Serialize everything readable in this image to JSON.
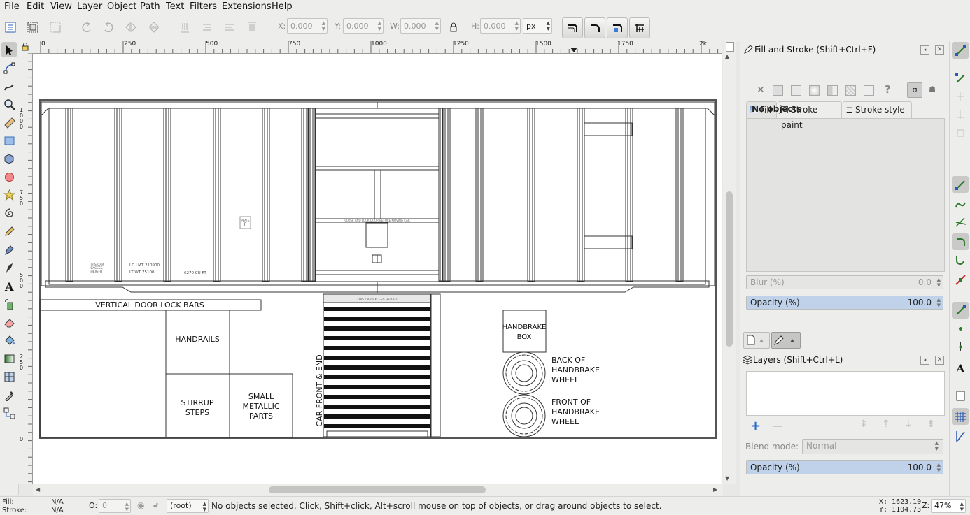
{
  "menu": [
    "File",
    "Edit",
    "View",
    "Layer",
    "Object",
    "Path",
    "Text",
    "Filters",
    "Extensions",
    "Help"
  ],
  "toolbar": {
    "x_label": "X:",
    "x_value": "0.000",
    "y_label": "Y:",
    "y_value": "0.000",
    "w_label": "W:",
    "w_value": "0.000",
    "h_label": "H:",
    "h_value": "0.000",
    "unit": "px"
  },
  "ruler": {
    "h_ticks": [
      "0",
      "250",
      "500",
      "750",
      "1000",
      "1250",
      "1500",
      "1750",
      "2k"
    ],
    "v_ticks": [
      "1\n0\n0\n0",
      "7\n5\n0",
      "5\n0\n0",
      "2\n5\n0",
      "0"
    ]
  },
  "drawing": {
    "labels": {
      "lock_bars": "VERTICAL DOOR LOCK BARS",
      "handrails": "HANDRAILS",
      "stirrup": "STIRRUP\nSTEPS",
      "small_parts": "SMALL\nMETALLIC\nPARTS",
      "car_front": "CAR FRONT & END",
      "handbrake_box": "HANDBRAKE\nBOX",
      "back_wheel": "BACK OF\nHANDBRAKE\nWHEEL",
      "front_wheel": "FRONT OF\nHANDBRAKE\nWHEEL",
      "excess_height": "THIS CAR\nEXCESS\nHEIGHT",
      "ld_lmt": "LD LMT    210900\nLT WT       75100",
      "cu_ft": "6270 CU FT",
      "plate": "PLATE\nF",
      "door_note": "CLOSE AND LOCK DOOR BEFORE MOVING CAR",
      "end_excess": "THIS CAR EXCESS HEIGHT"
    }
  },
  "fill_stroke": {
    "title": "Fill and Stroke (Shift+Ctrl+F)",
    "tabs": [
      "Fill",
      "Stroke paint",
      "Stroke style"
    ],
    "no_objects": "No objects",
    "blur_label": "Blur (%)",
    "blur_value": "0.0",
    "opacity_label": "Opacity (%)",
    "opacity_value": "100.0"
  },
  "layers": {
    "title": "Layers (Shift+Ctrl+L)",
    "blend_label": "Blend mode:",
    "blend_value": "Normal",
    "opacity_label": "Opacity (%)",
    "opacity_value": "100.0"
  },
  "status": {
    "fill_label": "Fill:",
    "fill_value": "N/A",
    "stroke_label": "Stroke:",
    "stroke_value": "N/A",
    "o_label": "O:",
    "o_value": "0",
    "layer": "(root)",
    "message": "No objects selected. Click, Shift+click, Alt+scroll mouse on top of objects, or drag around objects to select.",
    "x_coord": "X: 1623.10",
    "y_coord": "Y: 1104.73",
    "zoom_label": "Z:",
    "zoom_value": "47%"
  },
  "colors": {
    "accent": "#3a7bd5",
    "selection": "#bfd2ea"
  }
}
